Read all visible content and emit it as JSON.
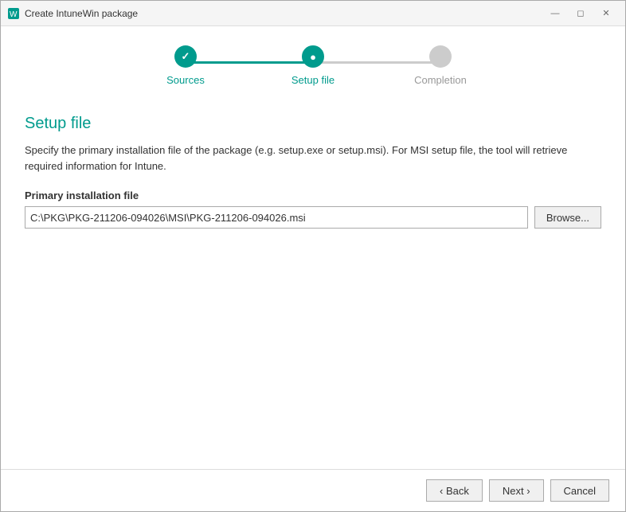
{
  "titlebar": {
    "title": "Create IntuneWin package",
    "minimize_label": "minimize",
    "maximize_label": "maximize",
    "close_label": "close"
  },
  "stepper": {
    "steps": [
      {
        "label": "Sources",
        "state": "completed"
      },
      {
        "label": "Setup file",
        "state": "active"
      },
      {
        "label": "Completion",
        "state": "inactive"
      }
    ]
  },
  "main": {
    "section_title": "Setup file",
    "description": "Specify the primary installation file of the package (e.g. setup.exe or setup.msi). For MSI setup file, the tool will retrieve required information for Intune.",
    "field_label": "Primary installation file",
    "field_value": "C:\\PKG\\PKG-211206-094026\\MSI\\PKG-211206-094026.msi",
    "field_placeholder": "",
    "browse_label": "Browse..."
  },
  "footer": {
    "back_label": "‹ Back",
    "next_label": "Next ›",
    "cancel_label": "Cancel"
  }
}
